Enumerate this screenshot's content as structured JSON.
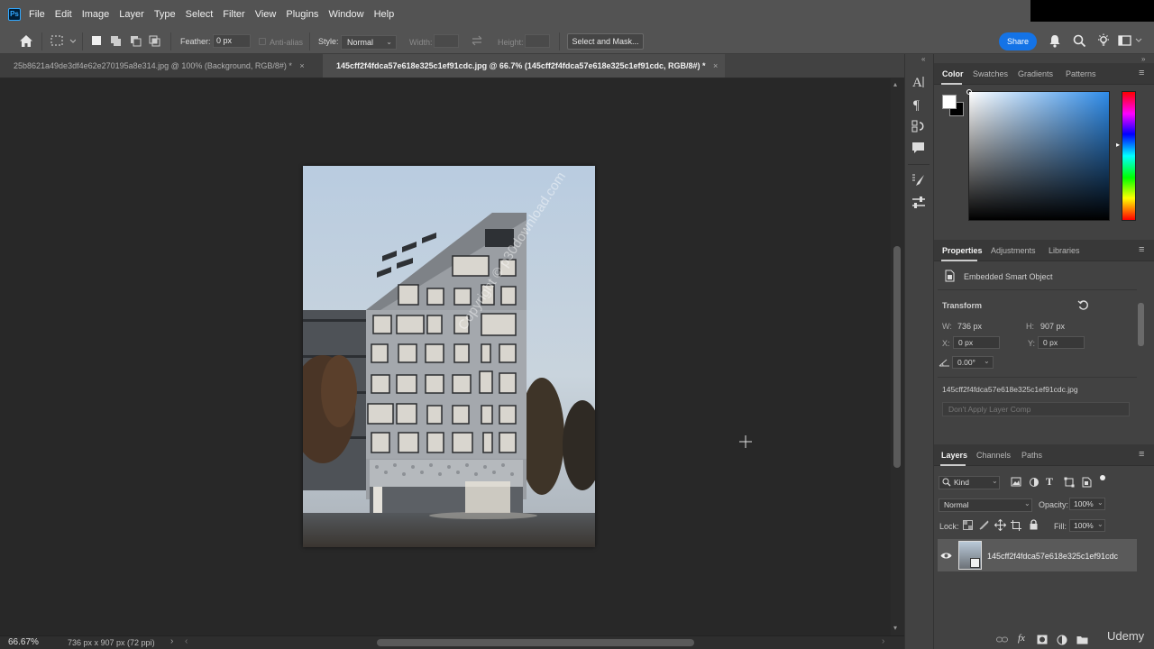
{
  "menu": {
    "logo": "Ps",
    "items": [
      "File",
      "Edit",
      "Image",
      "Layer",
      "Type",
      "Select",
      "Filter",
      "View",
      "Plugins",
      "Window",
      "Help"
    ]
  },
  "options": {
    "feather_label": "Feather:",
    "feather_value": "0 px",
    "anti_alias": "Anti-alias",
    "style_label": "Style:",
    "style_value": "Normal",
    "width_label": "Width:",
    "height_label": "Height:",
    "select_mask": "Select and Mask...",
    "share": "Share"
  },
  "tabs": [
    {
      "label": "25b8621a49de3df4e62e270195a8e314.jpg @ 100% (Background, RGB/8#) *",
      "active": false
    },
    {
      "label": "145cff2f4fdca57e618e325c1ef91cdc.jpg @ 66.7% (145cff2f4fdca57e618e325c1ef91cdc, RGB/8#) *",
      "active": true
    }
  ],
  "tab_close": "×",
  "canvas": {
    "watermark": "Copyright © p30download.com"
  },
  "status": {
    "zoom": "66.67%",
    "doc_size": "736 px x 907 px (72 ppi)"
  },
  "color_panel": {
    "tabs": [
      "Color",
      "Swatches",
      "Gradients",
      "Patterns"
    ],
    "foreground": "#ffffff",
    "background": "#000000"
  },
  "properties_panel": {
    "tabs": [
      "Properties",
      "Adjustments",
      "Libraries"
    ],
    "kind": "Embedded Smart Object",
    "section": "Transform",
    "w_label": "W:",
    "w_value": "736 px",
    "h_label": "H:",
    "h_value": "907 px",
    "x_label": "X:",
    "x_value": "0 px",
    "y_label": "Y:",
    "y_value": "0 px",
    "angle": "0.00°",
    "filename": "145cff2f4fdca57e618e325c1ef91cdc.jpg",
    "layer_comp": "Don't Apply Layer Comp"
  },
  "layers_panel": {
    "tabs": [
      "Layers",
      "Channels",
      "Paths"
    ],
    "filter_kind": "Kind",
    "blend_mode": "Normal",
    "opacity_label": "Opacity:",
    "opacity_value": "100%",
    "lock_label": "Lock:",
    "fill_label": "Fill:",
    "fill_value": "100%",
    "layer_name": "145cff2f4fdca57e618e325c1ef91cdc"
  },
  "brand_watermark": "Udemy"
}
